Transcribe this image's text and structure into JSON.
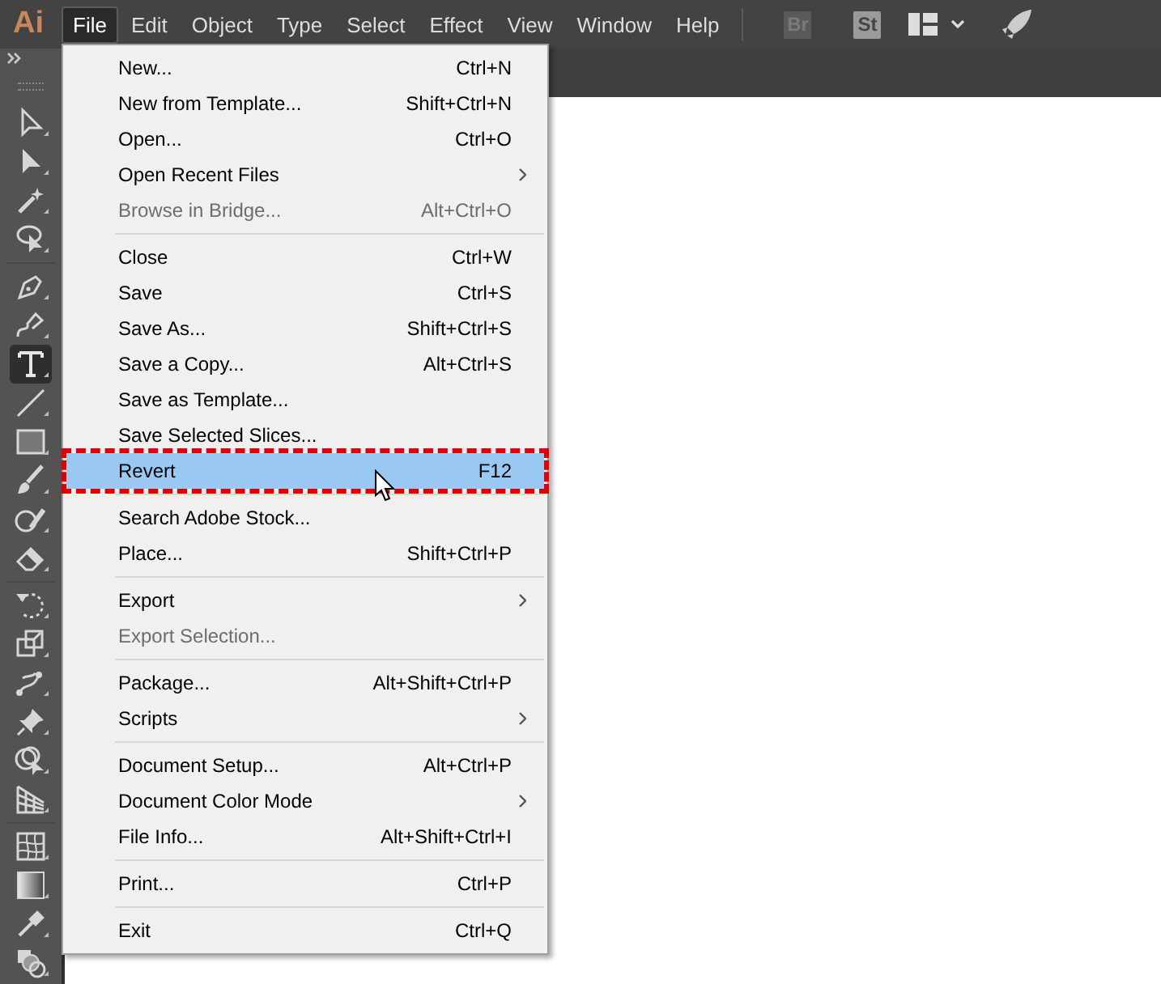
{
  "app_logo": "Ai",
  "menubar": [
    {
      "label": "File",
      "selected": true
    },
    {
      "label": "Edit",
      "selected": false
    },
    {
      "label": "Object",
      "selected": false
    },
    {
      "label": "Type",
      "selected": false
    },
    {
      "label": "Select",
      "selected": false
    },
    {
      "label": "Effect",
      "selected": false
    },
    {
      "label": "View",
      "selected": false
    },
    {
      "label": "Window",
      "selected": false
    },
    {
      "label": "Help",
      "selected": false
    }
  ],
  "app_buttons": [
    {
      "label": "Br",
      "disabled": true
    },
    {
      "label": "St",
      "disabled": false
    }
  ],
  "tools": [
    {
      "kind": "selection",
      "selected": false
    },
    {
      "kind": "direct",
      "selected": false
    },
    {
      "kind": "wand",
      "selected": false
    },
    {
      "kind": "lasso",
      "selected": false
    },
    {
      "kind": "separator"
    },
    {
      "kind": "pen",
      "selected": false
    },
    {
      "kind": "curvature",
      "selected": false
    },
    {
      "kind": "type",
      "selected": true
    },
    {
      "kind": "line",
      "selected": false
    },
    {
      "kind": "rectangle",
      "selected": false
    },
    {
      "kind": "brush",
      "selected": false
    },
    {
      "kind": "shaper",
      "selected": false
    },
    {
      "kind": "eraser",
      "selected": false
    },
    {
      "kind": "separator"
    },
    {
      "kind": "rotate",
      "selected": false
    },
    {
      "kind": "scale",
      "selected": false
    },
    {
      "kind": "puppet",
      "selected": false
    },
    {
      "kind": "pin",
      "selected": false
    },
    {
      "kind": "shapebuilder",
      "selected": false
    },
    {
      "kind": "perspective",
      "selected": false
    },
    {
      "kind": "separator"
    },
    {
      "kind": "mesh",
      "selected": false
    },
    {
      "kind": "gradient",
      "selected": false
    },
    {
      "kind": "eyedropper",
      "selected": false
    },
    {
      "kind": "blend",
      "selected": false
    }
  ],
  "file_menu": [
    {
      "kind": "item",
      "label": "New...",
      "shortcut": "Ctrl+N",
      "submenu": false,
      "disabled": false,
      "selected": false,
      "outlined": false
    },
    {
      "kind": "item",
      "label": "New from Template...",
      "shortcut": "Shift+Ctrl+N",
      "submenu": false,
      "disabled": false,
      "selected": false,
      "outlined": false
    },
    {
      "kind": "item",
      "label": "Open...",
      "shortcut": "Ctrl+O",
      "submenu": false,
      "disabled": false,
      "selected": false,
      "outlined": false
    },
    {
      "kind": "item",
      "label": "Open Recent Files",
      "submenu": true,
      "disabled": false,
      "selected": false,
      "outlined": false
    },
    {
      "kind": "item",
      "label": "Browse in Bridge...",
      "shortcut": "Alt+Ctrl+O",
      "submenu": false,
      "disabled": true,
      "selected": false,
      "outlined": false
    },
    {
      "kind": "separator"
    },
    {
      "kind": "item",
      "label": "Close",
      "shortcut": "Ctrl+W",
      "submenu": false,
      "disabled": false,
      "selected": false,
      "outlined": false
    },
    {
      "kind": "item",
      "label": "Save",
      "shortcut": "Ctrl+S",
      "submenu": false,
      "disabled": false,
      "selected": false,
      "outlined": false
    },
    {
      "kind": "item",
      "label": "Save As...",
      "shortcut": "Shift+Ctrl+S",
      "submenu": false,
      "disabled": false,
      "selected": false,
      "outlined": false
    },
    {
      "kind": "item",
      "label": "Save a Copy...",
      "shortcut": "Alt+Ctrl+S",
      "submenu": false,
      "disabled": false,
      "selected": false,
      "outlined": false
    },
    {
      "kind": "item",
      "label": "Save as Template...",
      "submenu": false,
      "disabled": false,
      "selected": false,
      "outlined": false
    },
    {
      "kind": "item",
      "label": "Save Selected Slices...",
      "submenu": false,
      "disabled": false,
      "selected": false,
      "outlined": false
    },
    {
      "kind": "item",
      "label": "Revert",
      "shortcut": "F12",
      "submenu": false,
      "disabled": false,
      "selected": true,
      "outlined": true
    },
    {
      "kind": "separator"
    },
    {
      "kind": "item",
      "label": "Search Adobe Stock...",
      "submenu": false,
      "disabled": false,
      "selected": false,
      "outlined": false
    },
    {
      "kind": "item",
      "label": "Place...",
      "shortcut": "Shift+Ctrl+P",
      "submenu": false,
      "disabled": false,
      "selected": false,
      "outlined": false
    },
    {
      "kind": "separator"
    },
    {
      "kind": "item",
      "label": "Export",
      "submenu": true,
      "disabled": false,
      "selected": false,
      "outlined": false
    },
    {
      "kind": "item",
      "label": "Export Selection...",
      "submenu": false,
      "disabled": true,
      "selected": false,
      "outlined": false
    },
    {
      "kind": "separator"
    },
    {
      "kind": "item",
      "label": "Package...",
      "shortcut": "Alt+Shift+Ctrl+P",
      "submenu": false,
      "disabled": false,
      "selected": false,
      "outlined": false
    },
    {
      "kind": "item",
      "label": "Scripts",
      "submenu": true,
      "disabled": false,
      "selected": false,
      "outlined": false
    },
    {
      "kind": "separator"
    },
    {
      "kind": "item",
      "label": "Document Setup...",
      "shortcut": "Alt+Ctrl+P",
      "submenu": false,
      "disabled": false,
      "selected": false,
      "outlined": false
    },
    {
      "kind": "item",
      "label": "Document Color Mode",
      "submenu": true,
      "disabled": false,
      "selected": false,
      "outlined": false
    },
    {
      "kind": "item",
      "label": "File Info...",
      "shortcut": "Alt+Shift+Ctrl+I",
      "submenu": false,
      "disabled": false,
      "selected": false,
      "outlined": false
    },
    {
      "kind": "separator"
    },
    {
      "kind": "item",
      "label": "Print...",
      "shortcut": "Ctrl+P",
      "submenu": false,
      "disabled": false,
      "selected": false,
      "outlined": false
    },
    {
      "kind": "separator"
    },
    {
      "kind": "item",
      "label": "Exit",
      "shortcut": "Ctrl+Q",
      "submenu": false,
      "disabled": false,
      "selected": false,
      "outlined": false
    }
  ]
}
